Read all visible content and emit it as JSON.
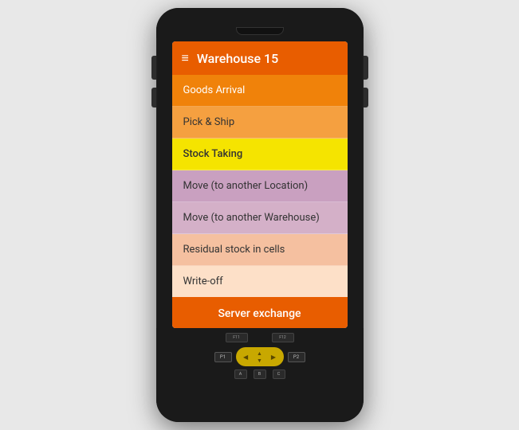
{
  "device": {
    "title": "Warehouse 15"
  },
  "header": {
    "title": "Warehouse 15",
    "menu_icon": "≡"
  },
  "menu": {
    "items": [
      {
        "id": "goods-arrival",
        "label": "Goods Arrival",
        "class": "menu-item-goods-arrival"
      },
      {
        "id": "pick-ship",
        "label": "Pick & Ship",
        "class": "menu-item-pick-ship"
      },
      {
        "id": "stock-taking",
        "label": "Stock Taking",
        "class": "menu-item-stock-taking"
      },
      {
        "id": "move-location",
        "label": "Move (to another Location)",
        "class": "menu-item-move-location"
      },
      {
        "id": "move-warehouse",
        "label": "Move (to another Warehouse)",
        "class": "menu-item-move-warehouse"
      },
      {
        "id": "residual",
        "label": "Residual stock in cells",
        "class": "menu-item-residual"
      },
      {
        "id": "writeoff",
        "label": "Write-off",
        "class": "menu-item-writeoff"
      }
    ],
    "server_exchange_label": "Server exchange"
  },
  "keypad": {
    "fn_keys": [
      "F11",
      "F12"
    ],
    "p_keys": [
      "P1",
      "P2"
    ],
    "abc_keys": [
      "A",
      "B",
      "C"
    ],
    "nav_arrows": [
      "◀",
      "▲",
      "▼",
      "▶"
    ]
  }
}
